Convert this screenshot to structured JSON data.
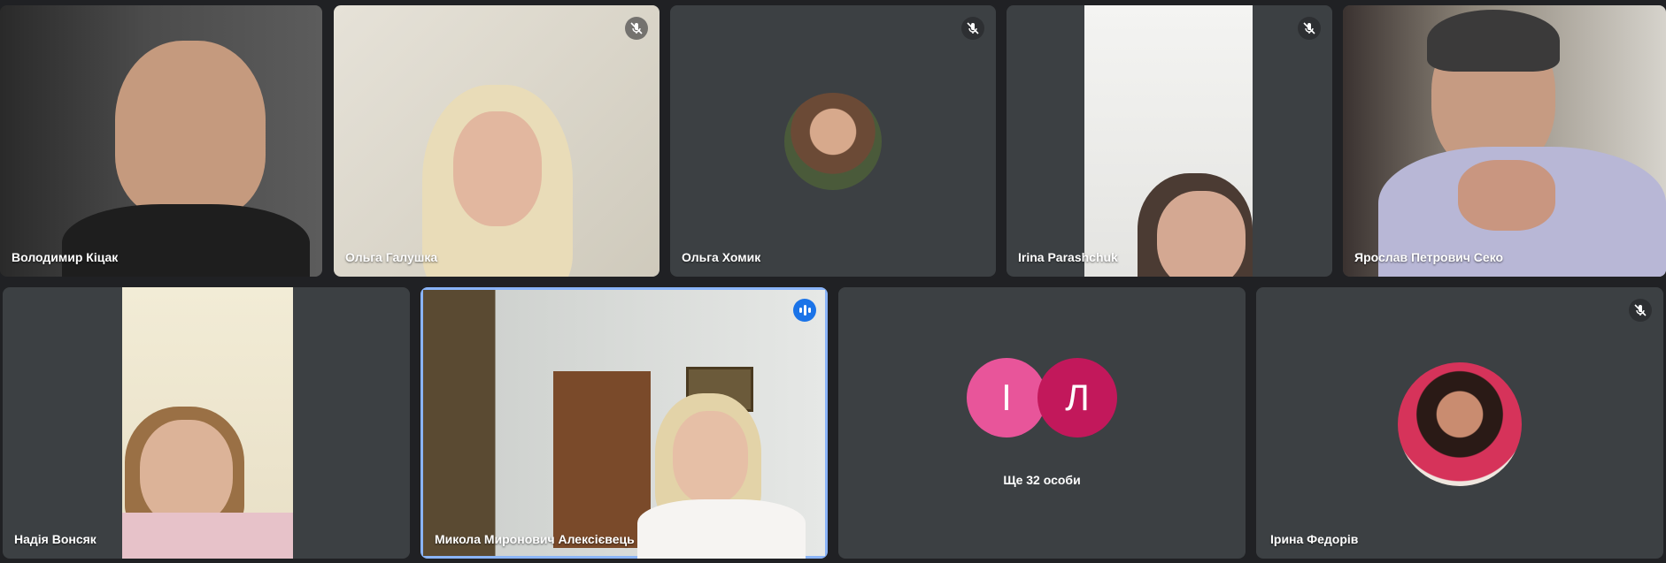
{
  "participants": {
    "p1": {
      "name": "Володимир Кіцак",
      "muted": false
    },
    "p2": {
      "name": "Ольга Галушка",
      "muted": true
    },
    "p3": {
      "name": "Ольга Хомик",
      "muted": true
    },
    "p4": {
      "name": "Irina Parashchuk",
      "muted": true
    },
    "p5": {
      "name": "Ярослав Петрович Секо",
      "muted": false
    },
    "p6": {
      "name": "Надія Вонсяк",
      "muted": false
    },
    "p7": {
      "name": "Микола Миронович Алексієвець",
      "speaking": true
    },
    "p8": {
      "initials": [
        "І",
        "Л"
      ],
      "more_label": "Ще 32 особи"
    },
    "p9": {
      "name": "Ірина Федорів",
      "muted": true
    }
  },
  "colors": {
    "tile_bg": "#3c4043",
    "page_bg": "#202124",
    "speaking_border": "#8ab4f8",
    "speaking_badge": "#1a73e8",
    "avatar_i": "#e8559a",
    "avatar_l": "#c2185b"
  },
  "icons": {
    "mute": "mic-off-icon",
    "speaking": "audio-level-icon"
  }
}
